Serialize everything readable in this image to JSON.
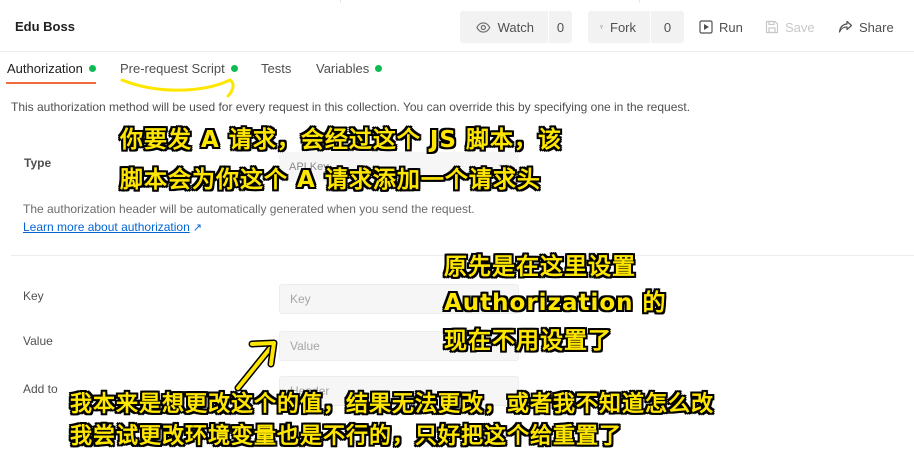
{
  "header": {
    "title": "Edu Boss",
    "watch_label": "Watch",
    "watch_count": "0",
    "fork_label": "Fork",
    "fork_count": "0",
    "run_label": "Run",
    "save_label": "Save",
    "share_label": "Share"
  },
  "tabs": [
    {
      "label": "Authorization",
      "dot": true
    },
    {
      "label": "Pre-request Script",
      "dot": true
    },
    {
      "label": "Tests",
      "dot": false
    },
    {
      "label": "Variables",
      "dot": true
    }
  ],
  "description": "This authorization method will be used for every request in this collection. You can override this by specifying one in the request.",
  "type": {
    "label": "Type",
    "selected": "API Key"
  },
  "helper_text": "The authorization header will be automatically generated when you send the request.",
  "learn_more": "Learn more about authorization",
  "fields": {
    "key_label": "Key",
    "key_placeholder": "Key",
    "value_label": "Value",
    "value_placeholder": "Value",
    "addto_label": "Add to",
    "addto_value": "Header"
  },
  "annotations": {
    "line1": "你要发 A 请求，会经过这个 JS 脚本，该",
    "line2": "脚本会为你这个 A 请求添加一个请求头",
    "line3": "原先是在这里设置",
    "line4": "Authorization 的",
    "line5": "现在不用设置了",
    "line6": "我本来是想更改这个的值，结果无法更改，或者我不知道怎么改",
    "line7": "我尝试更改环境变量也是不行的，只好把这个给重置了",
    "text_color": "#ffe600"
  },
  "colors": {
    "active_tab_underline": "#f26b3a",
    "status_dot": "#0cbb52",
    "link": "#0265d2"
  }
}
